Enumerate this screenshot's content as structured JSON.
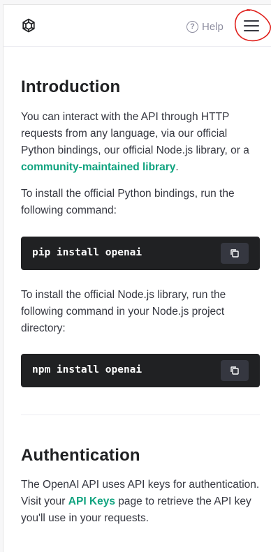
{
  "header": {
    "logo_icon": "openai-logo-icon",
    "help_icon": "question-circle-icon",
    "help_label": "Help",
    "menu_icon": "hamburger-menu-icon"
  },
  "intro": {
    "title": "Introduction",
    "p1_text": "You can interact with the API through HTTP requests from any language, via our official Python bindings, our official Node.js library, or a ",
    "p1_link": "community-maintained library",
    "p1_end": ".",
    "p2": "To install the official Python bindings, run the following command:",
    "code1": "pip install openai",
    "p3": "To install the official Node.js library, run the following command in your Node.js project directory:",
    "code2": "npm install openai"
  },
  "auth": {
    "title": "Authentication",
    "p1_start": "The OpenAI API uses API keys for authentication. Visit your ",
    "p1_link": "API Keys",
    "p1_end": " page to retrieve the API key you'll use in your requests."
  },
  "colors": {
    "accent": "#10a37f",
    "code_bg": "#202123",
    "annotation": "#e0201c"
  }
}
